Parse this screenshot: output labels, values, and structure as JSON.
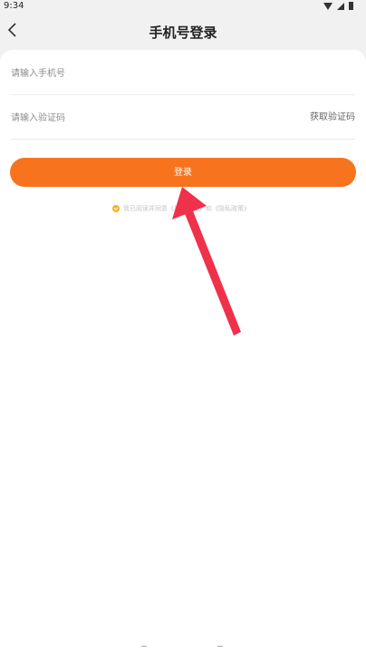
{
  "status_bar": {
    "time": "9:34"
  },
  "header": {
    "title": "手机号登录"
  },
  "form": {
    "phone_placeholder": "请输入手机号",
    "code_placeholder": "请输入验证码",
    "get_code_label": "获取验证码",
    "login_label": "登录"
  },
  "agreement": {
    "text": "我已阅读并同意《用户协议》和《隐私政策》",
    "checked": true
  },
  "colors": {
    "accent": "#f7731e",
    "annotation_arrow": "#f0314b",
    "checkbox": "#f3b11e"
  }
}
